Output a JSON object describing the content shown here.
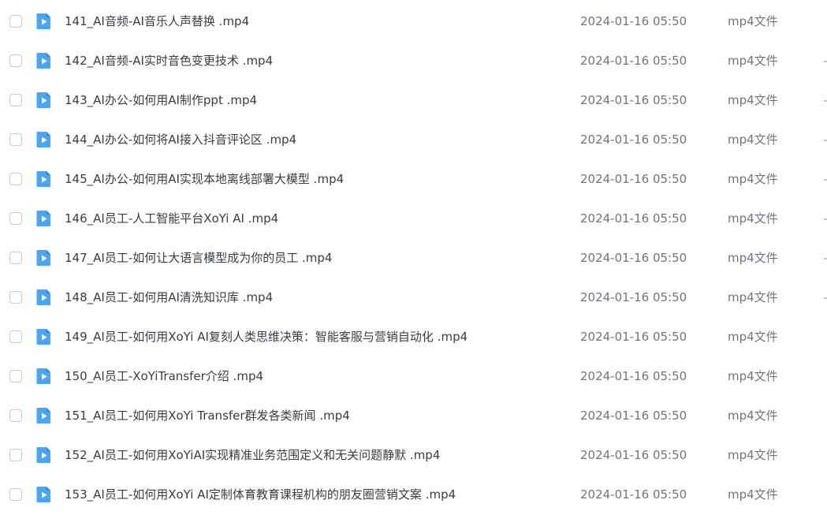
{
  "file_list": {
    "rows": [
      {
        "name": "141_AI音频-AI音乐人声替换 .mp4",
        "time": "2024-01-16 05:50",
        "type": "mp4文件"
      },
      {
        "name": "142_AI音频-AI实时音色变更技术 .mp4",
        "time": "2024-01-16 05:50",
        "type": "mp4文件"
      },
      {
        "name": "143_AI办公-如何用AI制作ppt .mp4",
        "time": "2024-01-16 05:50",
        "type": "mp4文件"
      },
      {
        "name": "144_AI办公-如何将AI接入抖音评论区 .mp4",
        "time": "2024-01-16 05:50",
        "type": "mp4文件"
      },
      {
        "name": "145_AI办公-如何用AI实现本地离线部署大模型 .mp4",
        "time": "2024-01-16 05:50",
        "type": "mp4文件"
      },
      {
        "name": "146_AI员工-人工智能平台XoYi AI .mp4",
        "time": "2024-01-16 05:50",
        "type": "mp4文件"
      },
      {
        "name": "147_AI员工-如何让大语言模型成为你的员工 .mp4",
        "time": "2024-01-16 05:50",
        "type": "mp4文件"
      },
      {
        "name": "148_AI员工-如何用AI清洗知识库 .mp4",
        "time": "2024-01-16 05:50",
        "type": "mp4文件"
      },
      {
        "name": "149_AI员工-如何用XoYi AI复刻人类思维决策：智能客服与营销自动化 .mp4",
        "time": "2024-01-16 05:50",
        "type": "mp4文件"
      },
      {
        "name": "150_AI员工-XoYiTransfer介绍 .mp4",
        "time": "2024-01-16 05:50",
        "type": "mp4文件"
      },
      {
        "name": "151_AI员工-如何用XoYi Transfer群发各类新闻 .mp4",
        "time": "2024-01-16 05:50",
        "type": "mp4文件"
      },
      {
        "name": "152_AI员工-如何用XoYiAI实现精准业务范围定义和无关问题静默 .mp4",
        "time": "2024-01-16 05:50",
        "type": "mp4文件"
      },
      {
        "name": "153_AI员工-如何用XoYi AI定制体育教育课程机构的朋友圈营销文案 .mp4",
        "time": "2024-01-16 05:50",
        "type": "mp4文件"
      }
    ],
    "icon": "video-file-icon",
    "colors": {
      "icon_accent": "#4aa5f5",
      "name_text": "#383c45",
      "meta_text": "#6f7480",
      "checkbox_border": "#c9ccd4"
    }
  }
}
